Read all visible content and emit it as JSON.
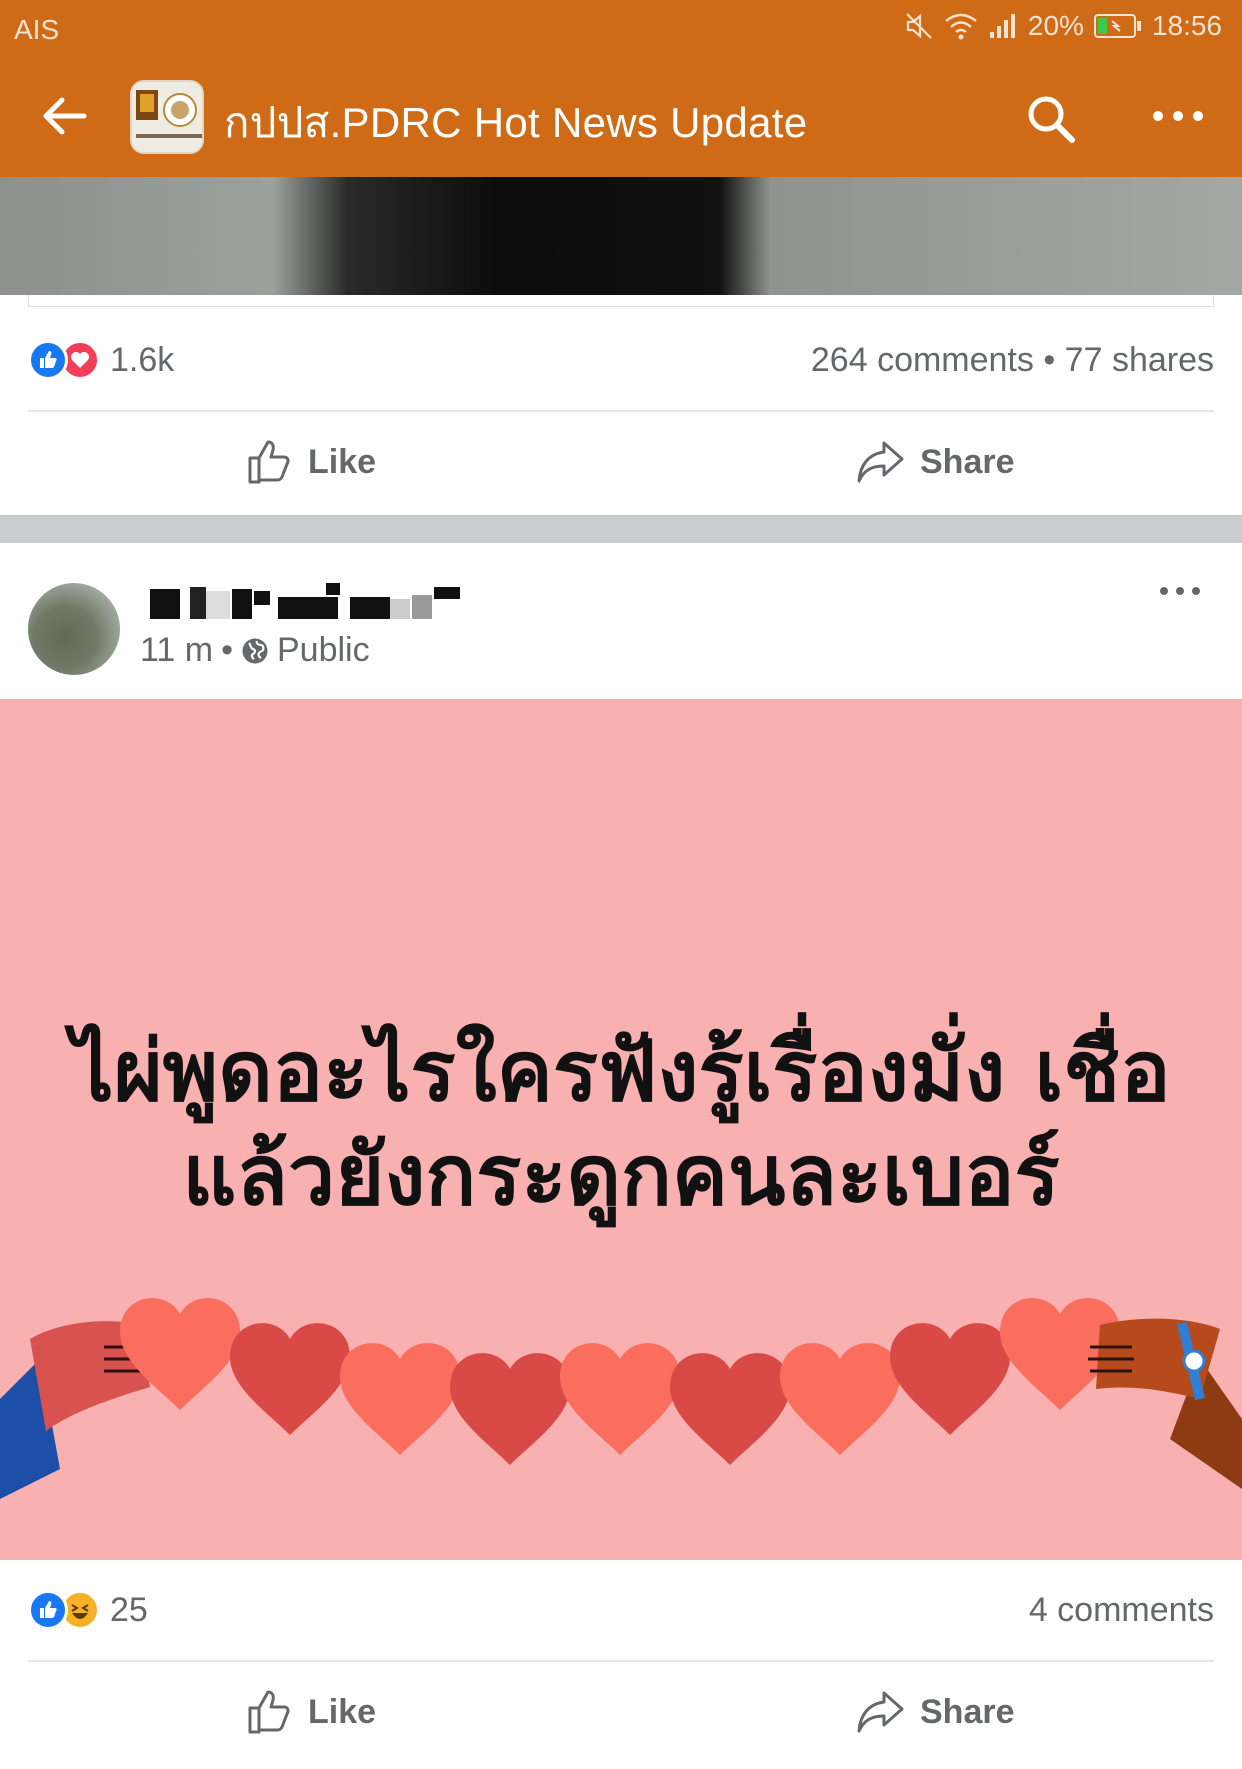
{
  "status_bar": {
    "carrier": "AIS",
    "battery": "20%",
    "time": "18:56"
  },
  "app_bar": {
    "title": "กปปส.PDRC Hot News Update"
  },
  "previous_post": {
    "reaction_count": "1.6k",
    "comments_shares": "264 comments • 77 shares",
    "like_label": "Like",
    "share_label": "Share"
  },
  "post": {
    "time": "11 m",
    "audience": "Public",
    "image_text_line1": "ไผ่พูดอะไรใครฟังรู้เรื่องมั่ง  เชื่อ",
    "image_text_line2": "แล้วยังกระดูกคนละเบอร์",
    "reaction_count": "25",
    "comments": "4 comments",
    "like_label": "Like",
    "share_label": "Share"
  },
  "colors": {
    "brand_orange": "#cf6b17",
    "post_background": "#f8b0b1"
  }
}
